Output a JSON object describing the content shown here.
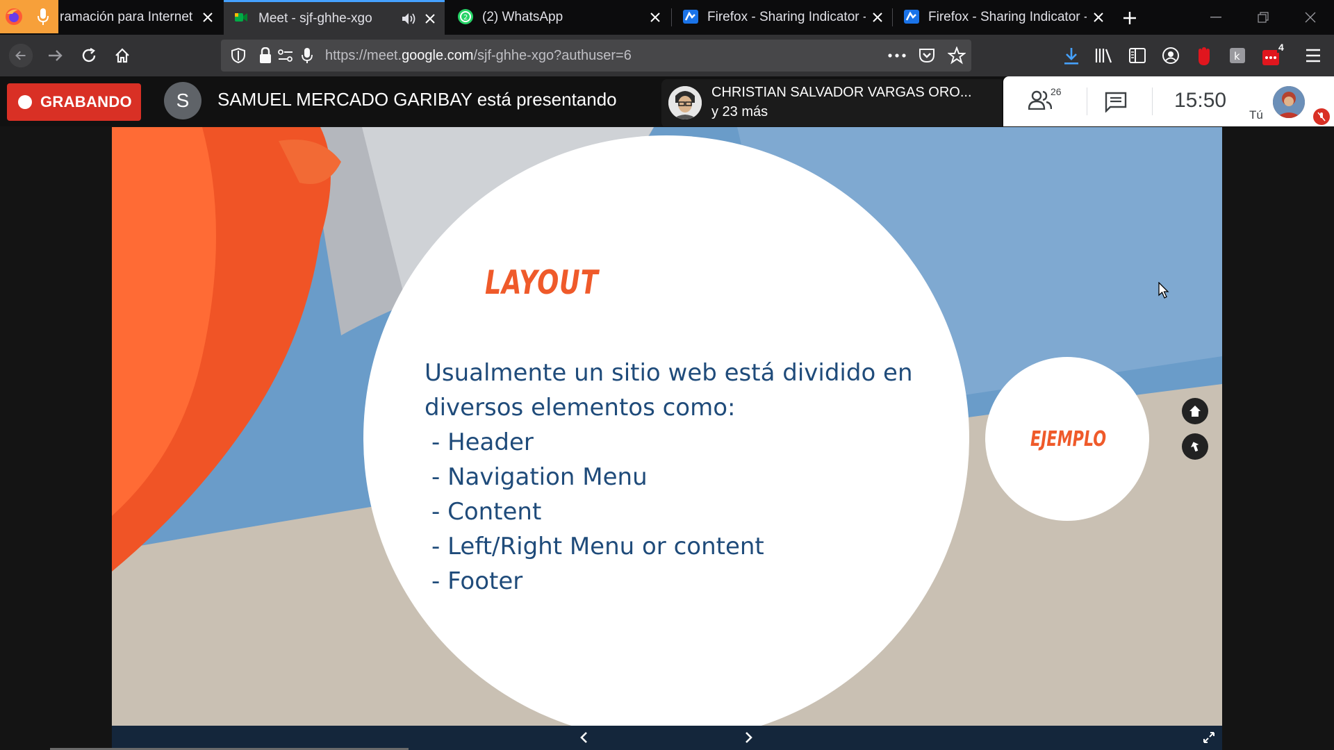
{
  "browser": {
    "tabs": [
      {
        "title": "ramación para Internet",
        "active": false,
        "favicon": "firefox-mic-icon"
      },
      {
        "title": "Meet - sjf-ghhe-xgo",
        "active": true,
        "favicon": "meet-icon",
        "audio": true
      },
      {
        "title": "(2) WhatsApp",
        "active": false,
        "favicon": "whatsapp-icon"
      },
      {
        "title": "Firefox - Sharing Indicator - C",
        "active": false,
        "favicon": "sharing-indicator-icon"
      },
      {
        "title": "Firefox - Sharing Indicator - C",
        "active": false,
        "favicon": "sharing-indicator-icon"
      }
    ],
    "url_prefix": "https://meet.",
    "url_domain": "google.com",
    "url_path": "/sjf-ghhe-xgo?authuser=6",
    "extension_badge": "4"
  },
  "meet": {
    "recording_label": "GRABANDO",
    "presenter_initial": "S",
    "presenting_text": "SAMUEL MERCADO GARIBAY está presentando",
    "participant_name": "CHRISTIAN SALVADOR VARGAS ORO...",
    "participant_more": "y 23 más",
    "people_count": "26",
    "time": "15:50",
    "self_label": "Tú"
  },
  "slide": {
    "title": "LAYOUT",
    "intro_line1": "Usualmente un sitio web está dividido en",
    "intro_line2": "diversos elementos como:",
    "items": [
      "- Header",
      "- Navigation Menu",
      "- Content",
      "- Left/Right Menu or content",
      "- Footer"
    ],
    "example_label": "EJEMPLO"
  },
  "colors": {
    "accent_orange": "#ef5a2a",
    "text_blue": "#1f4b7a",
    "record_red": "#d93025",
    "tab_highlight": "#45a1ff"
  }
}
